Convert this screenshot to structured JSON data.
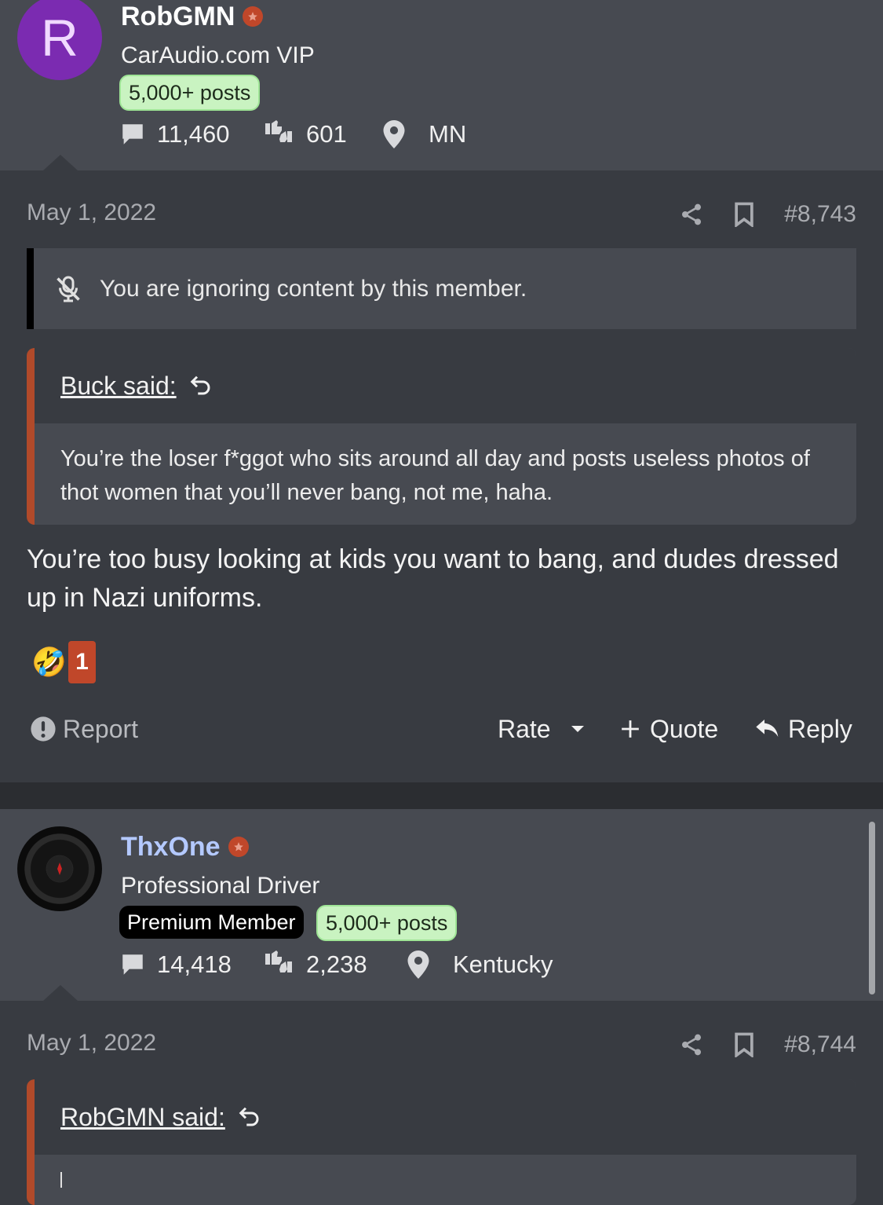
{
  "posts": [
    {
      "avatar_letter": "R",
      "username": "RobGMN",
      "user_title": "CarAudio.com VIP",
      "badges": [
        "5,000+ posts"
      ],
      "messages_count": "11,460",
      "reaction_score": "601",
      "location": "MN",
      "date": "May 1, 2022",
      "post_number": "#8,743",
      "ignored_notice": "You are ignoring content by this member.",
      "quote": {
        "author_label": "Buck said:",
        "text": "You’re the loser f*ggot who sits around all day and posts useless photos of thot women that you’ll never bang, not me, haha."
      },
      "message": "You’re too busy looking at kids you want to bang, and dudes dressed up in Nazi uniforms.",
      "reaction_emoji": "🤣",
      "reaction_count": "1",
      "actions": {
        "report": "Report",
        "rate": "Rate",
        "quote": "Quote",
        "reply": "Reply"
      }
    },
    {
      "username": "ThxOne",
      "user_title": "Professional Driver",
      "badges": [
        "Premium Member",
        "5,000+ posts"
      ],
      "messages_count": "14,418",
      "reaction_score": "2,238",
      "location": "Kentucky",
      "date": "May 1, 2022",
      "post_number": "#8,744",
      "quote": {
        "author_label": "RobGMN said:"
      }
    }
  ],
  "colors": {
    "header_bg": "#474a51",
    "post_bg": "#383b41",
    "accent_orange": "#c0472a",
    "badge_green": "#c9f3c1",
    "username_blue": "#b4c9ff"
  }
}
